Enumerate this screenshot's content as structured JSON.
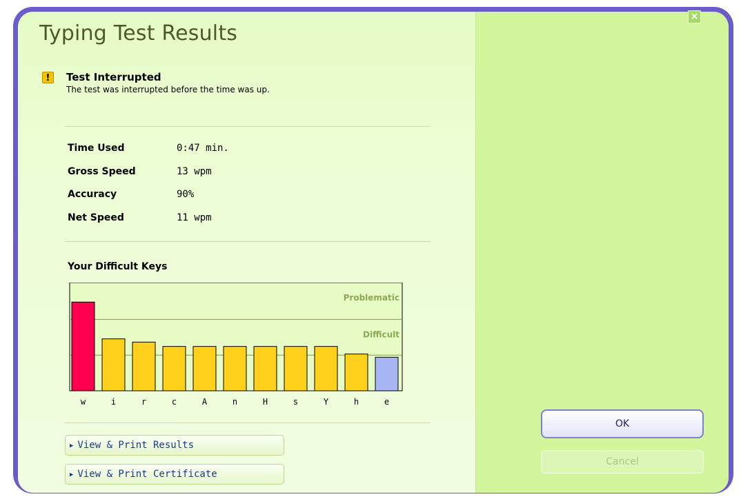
{
  "window": {
    "title": "Typing Test Results",
    "close_icon": "close-icon"
  },
  "warning": {
    "icon": "warning-icon",
    "icon_glyph": "!",
    "title": "Test Interrupted",
    "message": "The test was interrupted before the time was up."
  },
  "stats": [
    {
      "label": "Time Used",
      "value": "0:47 min."
    },
    {
      "label": "Gross Speed",
      "value": "13 wpm"
    },
    {
      "label": "Accuracy",
      "value": "90%"
    },
    {
      "label": "Net Speed",
      "value": "11 wpm"
    }
  ],
  "difficult_keys": {
    "heading": "Your Difficult Keys",
    "colors": {
      "problematic": "#ff0050",
      "difficult": "#ffd01c",
      "normal": "#a8b6f5"
    }
  },
  "chart_data": {
    "type": "bar",
    "title": "Your Difficult Keys",
    "categories": [
      "w",
      "i",
      "r",
      "c",
      "A",
      "n",
      "H",
      "s",
      "Y",
      "h",
      "e"
    ],
    "values": [
      82,
      48,
      45,
      41,
      41,
      41,
      41,
      41,
      41,
      34,
      31
    ],
    "levels": [
      "problematic",
      "difficult",
      "difficult",
      "difficult",
      "difficult",
      "difficult",
      "difficult",
      "difficult",
      "difficult",
      "difficult",
      "normal"
    ],
    "ylim": [
      0,
      100
    ],
    "bands": [
      {
        "label": "Problematic",
        "from": 66,
        "to": 100
      },
      {
        "label": "Difficult",
        "from": 33,
        "to": 66
      }
    ],
    "grid": true,
    "legend": "none"
  },
  "actions": {
    "view_results": "View & Print Results",
    "view_certificate": "View & Print Certificate",
    "ok": "OK",
    "cancel": "Cancel"
  }
}
